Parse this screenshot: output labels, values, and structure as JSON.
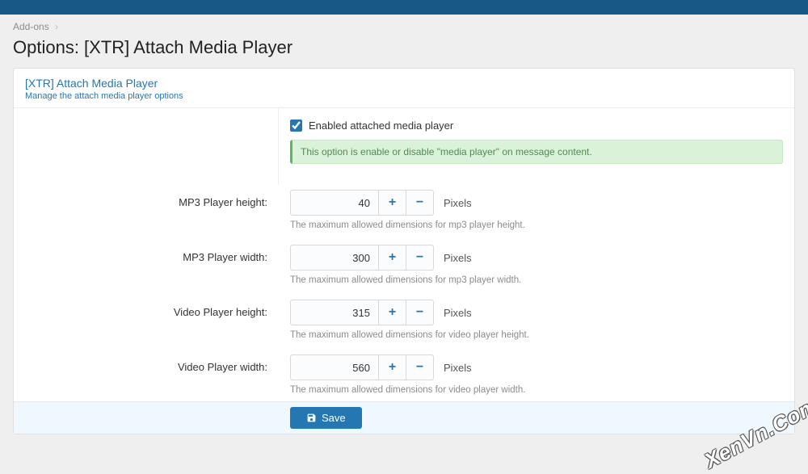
{
  "breadcrumb": {
    "addons": "Add-ons"
  },
  "page_title": "Options: [XTR] Attach Media Player",
  "panel": {
    "title": "[XTR] Attach Media Player",
    "subtitle": "Manage the attach media player options"
  },
  "form": {
    "enabled": {
      "label": "Enabled attached media player",
      "checked": true,
      "info": "This option is enable or disable \"media player\" on message content."
    },
    "fields": [
      {
        "label": "MP3 Player height:",
        "value": "40",
        "unit": "Pixels",
        "hint": "The maximum allowed dimensions for mp3 player height."
      },
      {
        "label": "MP3 Player width:",
        "value": "300",
        "unit": "Pixels",
        "hint": "The maximum allowed dimensions for mp3 player width."
      },
      {
        "label": "Video Player height:",
        "value": "315",
        "unit": "Pixels",
        "hint": "The maximum allowed dimensions for video player height."
      },
      {
        "label": "Video Player width:",
        "value": "560",
        "unit": "Pixels",
        "hint": "The maximum allowed dimensions for video player width."
      }
    ],
    "save_label": "Save"
  },
  "watermark": "XenVn.Com"
}
